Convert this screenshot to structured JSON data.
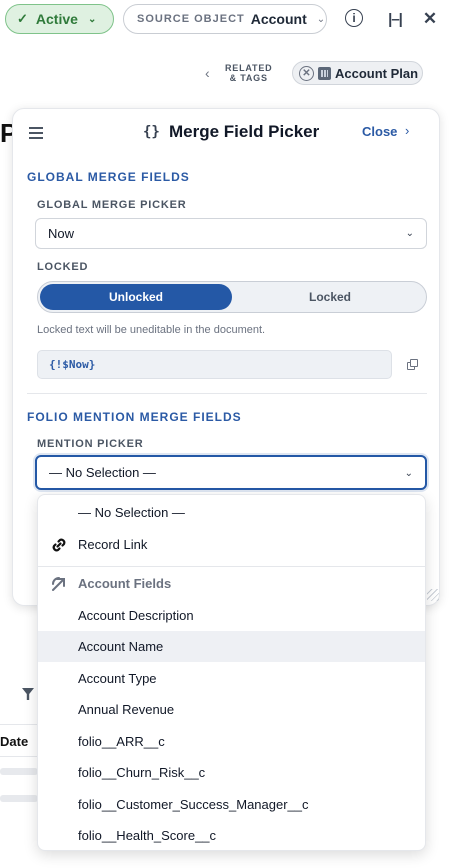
{
  "topbar": {
    "status_label": "Active",
    "source_label": "SOURCE OBJECT",
    "source_value": "Account"
  },
  "tags": {
    "related_line1": "RELATED",
    "related_line2": "& TAGS",
    "chip_label": "Account Plan"
  },
  "background": {
    "letter": "P",
    "date_header": "Date"
  },
  "panel": {
    "brace": "{}",
    "title": "Merge Field Picker",
    "close_label": "Close",
    "global_heading": "GLOBAL MERGE FIELDS",
    "global_picker_label": "GLOBAL MERGE PICKER",
    "global_picker_value": "Now",
    "locked_label": "LOCKED",
    "toggle_on": "Unlocked",
    "toggle_off": "Locked",
    "locked_hint": "Locked text will be uneditable in the document.",
    "merge_code": "{!$Now}",
    "folio_heading": "FOLIO MENTION MERGE FIELDS",
    "mention_label": "MENTION PICKER",
    "mention_value": "— No Selection —"
  },
  "dropdown": {
    "items": [
      {
        "label": "— No Selection —"
      },
      {
        "label": "Record Link",
        "icon": "link-icon"
      },
      {
        "label": "Account Fields",
        "icon": "arrow-reference-icon",
        "group": true
      },
      {
        "label": "Account Description"
      },
      {
        "label": "Account Name",
        "highlighted": true
      },
      {
        "label": "Account Type"
      },
      {
        "label": "Annual Revenue"
      },
      {
        "label": "folio__ARR__c"
      },
      {
        "label": "folio__Churn_Risk__c"
      },
      {
        "label": "folio__Customer_Success_Manager__c"
      },
      {
        "label": "folio__Health_Score__c"
      }
    ]
  },
  "colors": {
    "accent": "#2458a6",
    "status_green": "#2f7a3a",
    "status_bg": "#dff1e1"
  }
}
